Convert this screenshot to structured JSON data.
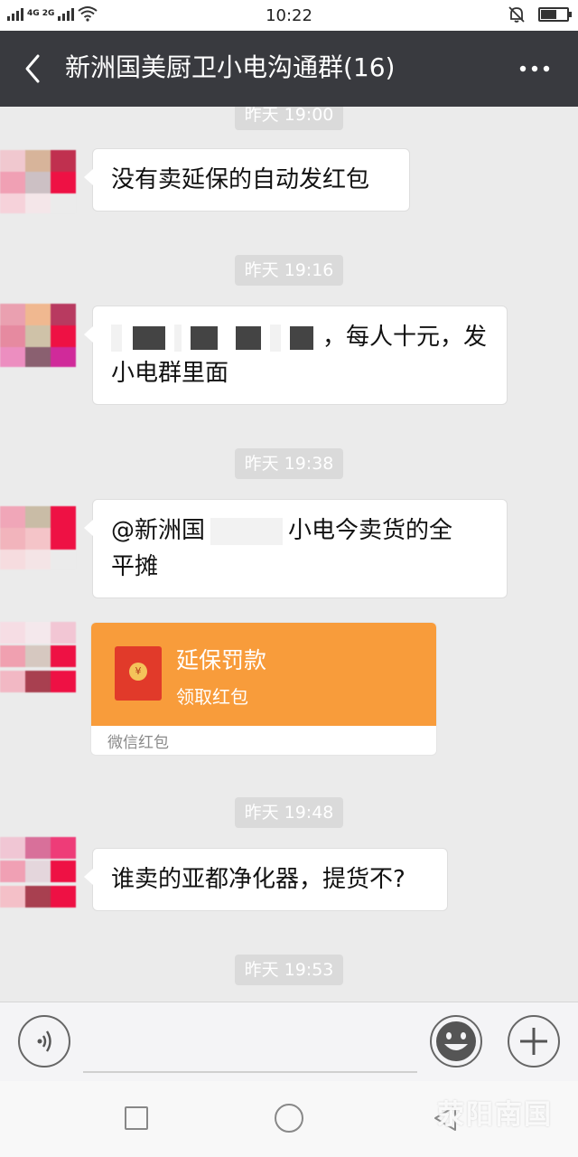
{
  "status_bar": {
    "network": "4G 2G",
    "time": "10:22"
  },
  "header": {
    "title": "新洲国美厨卫小电沟通群(16)"
  },
  "chat": {
    "messages": [
      {
        "time": "昨天 19:00",
        "text": "没有卖延保的自动发红包"
      },
      {
        "time": "昨天 19:16",
        "text_end": "，每人十元，发",
        "text_line2": "小电群里面"
      },
      {
        "time": "昨天 19:38",
        "text_start": "@新洲国",
        "text_mid": "小电今卖货的全",
        "text_line2": "平摊"
      },
      {
        "red_packet": {
          "title": "延保罚款",
          "subtitle": "领取红包",
          "footer": "微信红包",
          "coin": "¥"
        }
      },
      {
        "time": "昨天 19:48",
        "text": "谁卖的亚都净化器，提货不?"
      },
      {
        "time": "昨天 19:53"
      }
    ]
  },
  "input_bar": {
    "placeholder": ""
  },
  "watermark": "荥阳南国",
  "colors": {
    "title_bar": "#393a3f",
    "chat_bg": "#ebebeb",
    "red_packet": "#f89c3b"
  }
}
